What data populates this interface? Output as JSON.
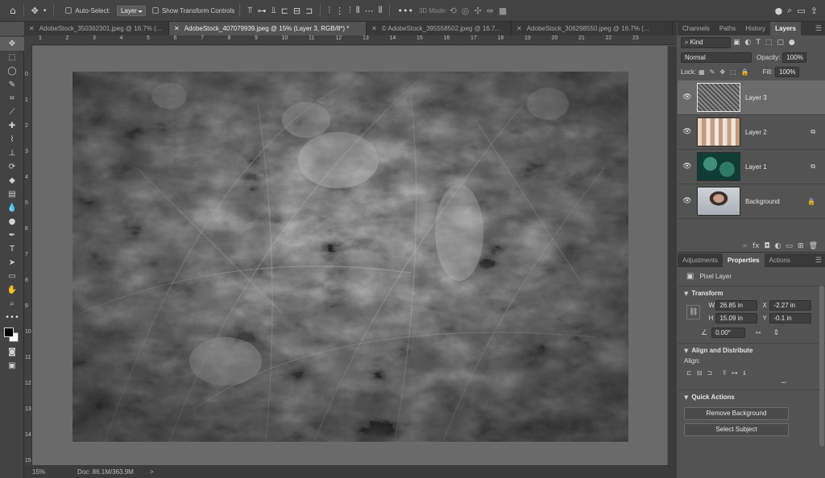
{
  "options_bar": {
    "home_icon": "home-icon",
    "move_icon": "move-tool-icon",
    "auto_select_label": "Auto-Select:",
    "auto_select_value": "Layer",
    "transform_controls_label": "Show Transform Controls",
    "mode_3d_label": "3D Mode:"
  },
  "document_tabs": [
    {
      "label": "AdobeStock_350362301.jpeg @ 16.7% (...",
      "active": false
    },
    {
      "label": "AdobeStock_407079939.jpeg @ 15% (Layer 3, RGB/8*) *",
      "active": true
    },
    {
      "label": "© AdobeStock_395558502.jpeg @ 16.7...",
      "active": false
    },
    {
      "label": "AdobeStock_306298550.jpeg @ 16.7% (...",
      "active": false
    }
  ],
  "ruler": {
    "top": [
      "1",
      "2",
      "3",
      "4",
      "5",
      "6",
      "7",
      "8",
      "9",
      "10",
      "11",
      "12",
      "13",
      "14",
      "15",
      "16",
      "17",
      "18",
      "19",
      "20",
      "21",
      "22",
      "23"
    ],
    "left": [
      "0",
      "1",
      "2",
      "3",
      "4",
      "5",
      "6",
      "7",
      "8",
      "9",
      "10",
      "11",
      "12",
      "13",
      "14",
      "15"
    ]
  },
  "status": {
    "zoom": "15%",
    "doc": "Doc: 86.1M/363.9M",
    "arrow": ">"
  },
  "top_panel": {
    "tabs": [
      "Channels",
      "Paths",
      "History",
      "Layers"
    ],
    "active_tab": "Layers",
    "filter_kind": "Kind",
    "blend_mode": "Normal",
    "opacity_label": "Opacity:",
    "opacity_value": "100%",
    "lock_label": "Lock:",
    "fill_label": "Fill:",
    "fill_value": "100%",
    "layers": [
      {
        "name": "Layer 3",
        "selected": true,
        "badge": ""
      },
      {
        "name": "Layer 2",
        "selected": false,
        "badge": "linked-smart-icon"
      },
      {
        "name": "Layer 1",
        "selected": false,
        "badge": "linked-smart-icon"
      },
      {
        "name": "Background",
        "selected": false,
        "badge": "lock-icon"
      }
    ]
  },
  "properties_panel": {
    "tabs": [
      "Adjustments",
      "Properties",
      "Actions"
    ],
    "active_tab": "Properties",
    "kind": "Pixel Layer",
    "transform": {
      "title": "Transform",
      "w_label": "W",
      "w": "26.85 in",
      "h_label": "H",
      "h": "15.09 in",
      "x_label": "X",
      "x": "-2.27 in",
      "y_label": "Y",
      "y": "-0.1 in",
      "angle": "0.00°"
    },
    "align": {
      "title": "Align and Distribute",
      "label": "Align:",
      "more": "..."
    },
    "quick_actions": {
      "title": "Quick Actions",
      "remove_bg": "Remove Background",
      "select_subject": "Select Subject"
    }
  }
}
